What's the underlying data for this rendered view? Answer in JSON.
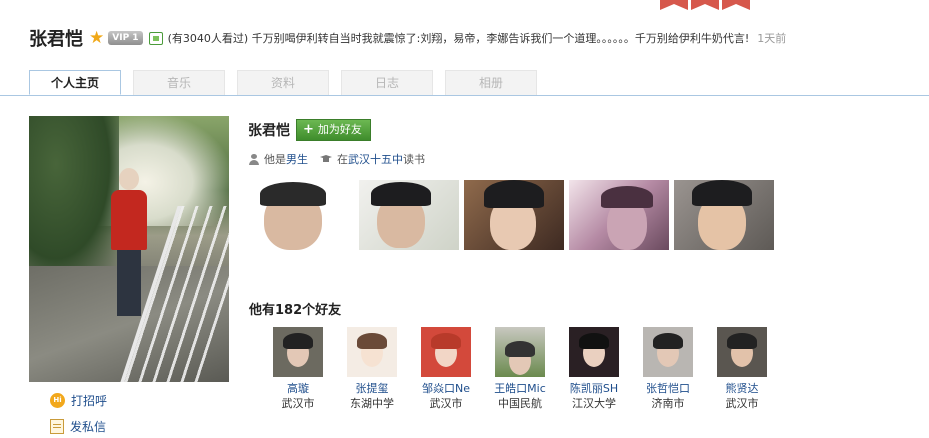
{
  "header": {
    "name": "张君恺",
    "vip_label": "VIP 1",
    "status_text": "(有3040人看过) 千万别喝伊利转自当时我就震惊了:刘翔，易帝，李娜告诉我们一个道理。。。。。。千万别给伊利牛奶代言!",
    "status_time": "1天前",
    "icons": [
      "star-icon",
      "vip-badge",
      "status-icon"
    ]
  },
  "tabs": [
    {
      "label": "个人主页",
      "active": true
    },
    {
      "label": "音乐",
      "active": false
    },
    {
      "label": "资料",
      "active": false
    },
    {
      "label": "日志",
      "active": false
    },
    {
      "label": "相册",
      "active": false
    }
  ],
  "sidebar": {
    "greet_label": "打招呼",
    "message_label": "发私信"
  },
  "profile": {
    "name": "张君恺",
    "add_friend_label": "加为好友",
    "gender_prefix": "他是",
    "gender": "男生",
    "school_prefix": "在",
    "school": "武汉十五中",
    "school_suffix": "读书"
  },
  "friends": {
    "title": "他有182个好友",
    "items": [
      {
        "name": "高璇",
        "place": "武汉市"
      },
      {
        "name": "张提玺",
        "place": "东湖中学"
      },
      {
        "name": "邹焱口Ne",
        "place": "武汉市"
      },
      {
        "name": "王皓口Mic",
        "place": "中国民航"
      },
      {
        "name": "陈凯丽SH",
        "place": "江汉大学"
      },
      {
        "name": "张哲恺口",
        "place": "济南市"
      },
      {
        "name": "熊贤达",
        "place": "武汉市"
      }
    ]
  },
  "colors": {
    "link": "#1f4e8c",
    "add_button": "#4a9e34",
    "tab_border": "#aac7e2",
    "deco": "#d6584c"
  }
}
